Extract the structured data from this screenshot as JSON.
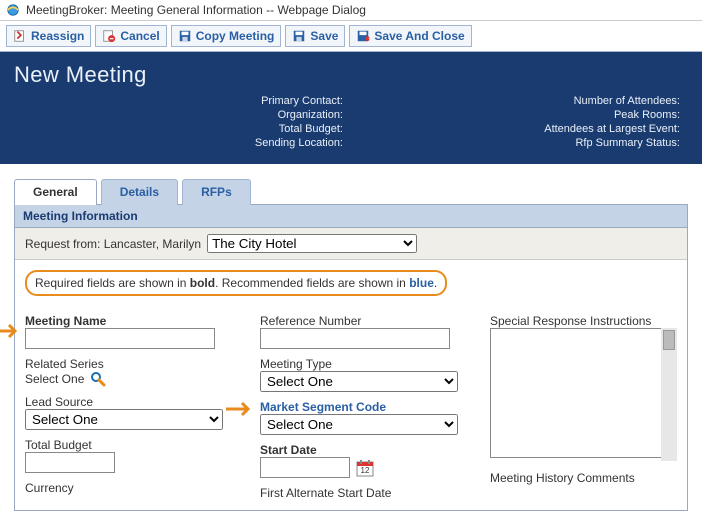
{
  "window": {
    "title": "MeetingBroker: Meeting General Information -- Webpage Dialog"
  },
  "toolbar": {
    "reassign": "Reassign",
    "cancel": "Cancel",
    "copy": "Copy Meeting",
    "save": "Save",
    "save_close": "Save And Close"
  },
  "header": {
    "title": "New Meeting",
    "left": {
      "primary_contact": "Primary Contact:",
      "organization": "Organization:",
      "total_budget": "Total Budget:",
      "sending_location": "Sending Location:"
    },
    "right": {
      "attendees": "Number of Attendees:",
      "peak_rooms": "Peak Rooms:",
      "largest_event": "Attendees at Largest Event:",
      "rfp_status": "Rfp Summary Status:"
    }
  },
  "tabs": {
    "general": "General",
    "details": "Details",
    "rfps": "RFPs"
  },
  "panel": {
    "title": "Meeting Information",
    "request_from_label": "Request from: Lancaster, Marilyn",
    "request_from_value": "The City Hotel",
    "callout_p1": "Required fields are shown in ",
    "callout_bold": "bold",
    "callout_p2": ". Recommended fields are shown in ",
    "callout_blue": "blue",
    "callout_p3": "."
  },
  "form": {
    "meeting_name": "Meeting Name",
    "related_series": "Related Series",
    "select_one": "Select One",
    "lead_source": "Lead Source",
    "total_budget": "Total Budget",
    "currency": "Currency",
    "reference_number": "Reference Number",
    "meeting_type": "Meeting Type",
    "market_segment": "Market Segment Code",
    "start_date": "Start Date",
    "first_alt_start": "First Alternate Start Date",
    "special_response": "Special Response Instructions",
    "meeting_history": "Meeting History Comments"
  }
}
